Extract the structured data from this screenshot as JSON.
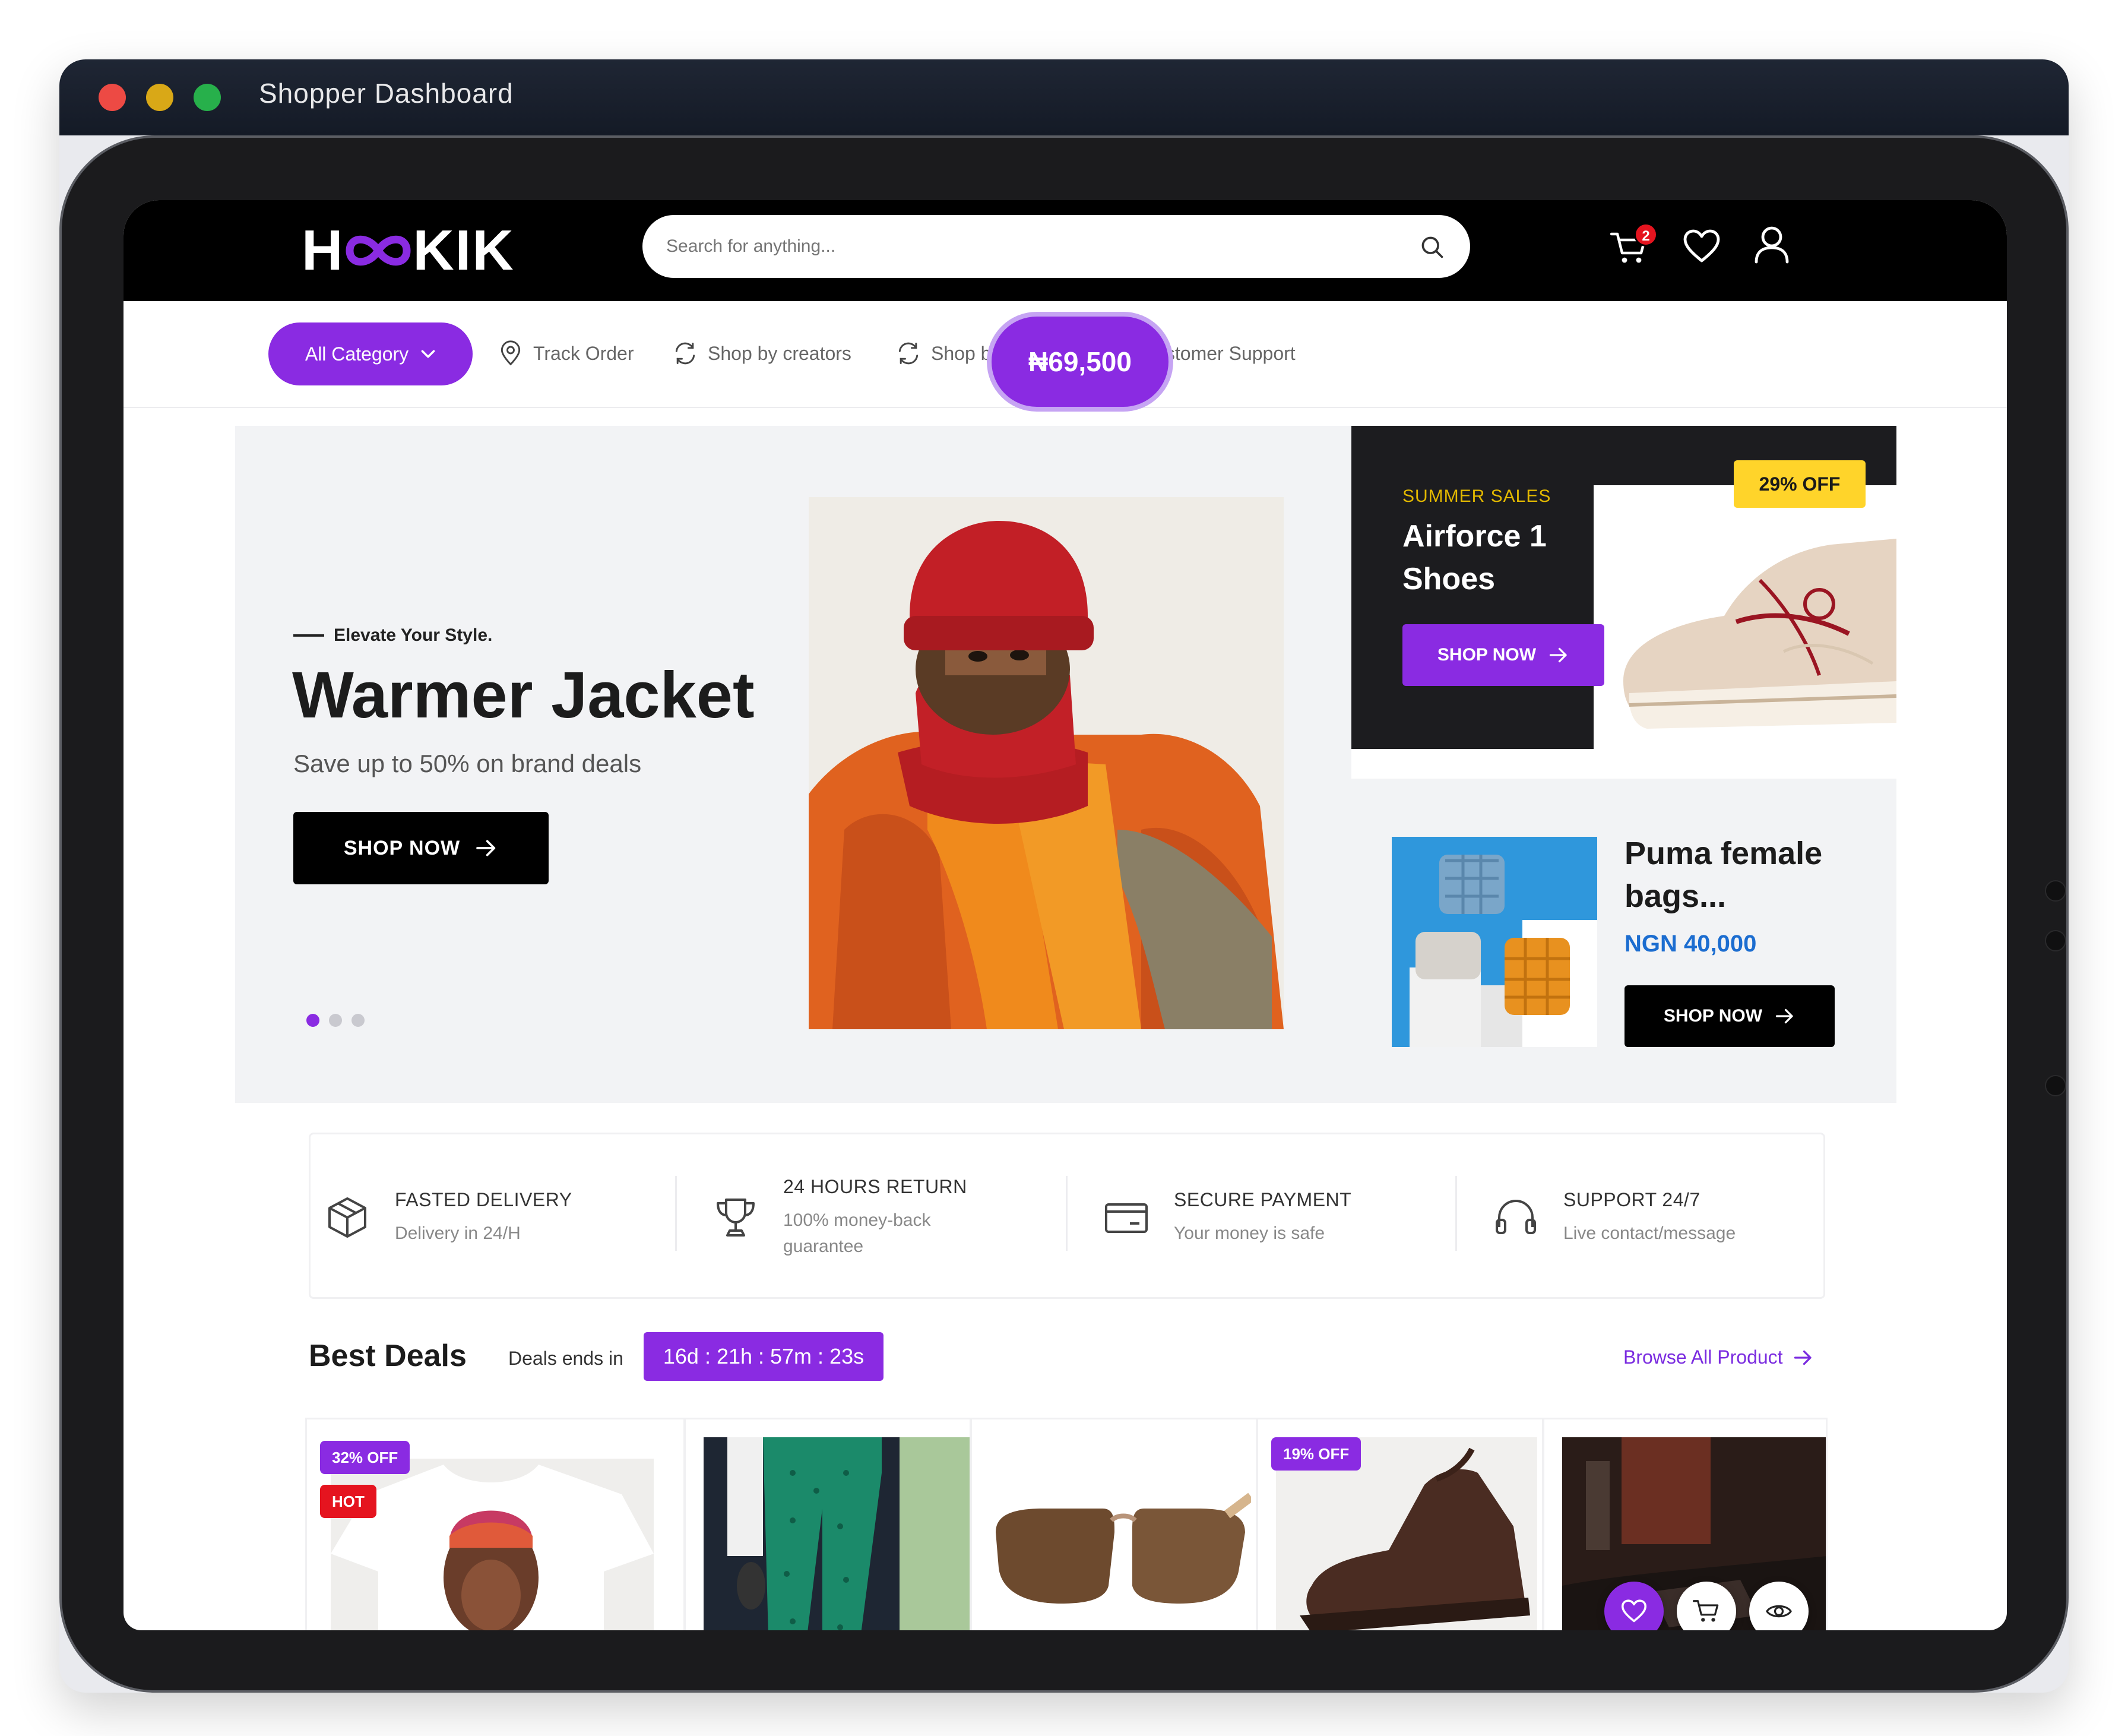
{
  "window": {
    "title": "Shopper  Dashboard"
  },
  "header": {
    "logo_left": "H",
    "logo_right": "KIK",
    "search_placeholder": "Search for anything...",
    "cart_count": "2"
  },
  "nav": {
    "all_category": "All Category",
    "links": [
      "Track Order",
      "Shop by creators",
      "Shop by brands",
      "Customer Support"
    ]
  },
  "hero": {
    "eyebrow": "Elevate Your Style.",
    "title": "Warmer Jacket",
    "subtitle": "Save up to 50% on brand deals",
    "button": "SHOP NOW",
    "price": "₦69,500",
    "slide_count": 3,
    "active_slide": 1
  },
  "summer": {
    "eyebrow": "SUMMER SALES",
    "title": "Airforce 1 Shoes",
    "button": "SHOP NOW",
    "badge": "29% OFF"
  },
  "puma": {
    "title": "Puma female bags...",
    "price": "NGN 40,000",
    "button": "SHOP NOW"
  },
  "features": [
    {
      "title": "FASTED DELIVERY",
      "sub": "Delivery in 24/H",
      "icon": "package-icon"
    },
    {
      "title": "24 HOURS RETURN",
      "sub": "100% money-back guarantee",
      "icon": "trophy-icon"
    },
    {
      "title": "SECURE PAYMENT",
      "sub": "Your money is safe",
      "icon": "credit-card-icon"
    },
    {
      "title": "SUPPORT 24/7",
      "sub": "Live contact/message",
      "icon": "headphones-icon"
    }
  ],
  "deals": {
    "title": "Best Deals",
    "ends_label": "Deals ends in",
    "timer": "16d : 21h : 57m : 23s",
    "browse": "Browse All Product",
    "products": [
      {
        "badges": [
          "32% OFF",
          "HOT"
        ]
      },
      {
        "badges": []
      },
      {
        "badges": []
      },
      {
        "badges": [
          "19% OFF"
        ]
      },
      {
        "badges": []
      }
    ]
  },
  "colors": {
    "accent": "#8a2be2",
    "hot": "#e5141f",
    "badge_yellow": "#ffd42a",
    "price_blue": "#1c6dd0"
  }
}
